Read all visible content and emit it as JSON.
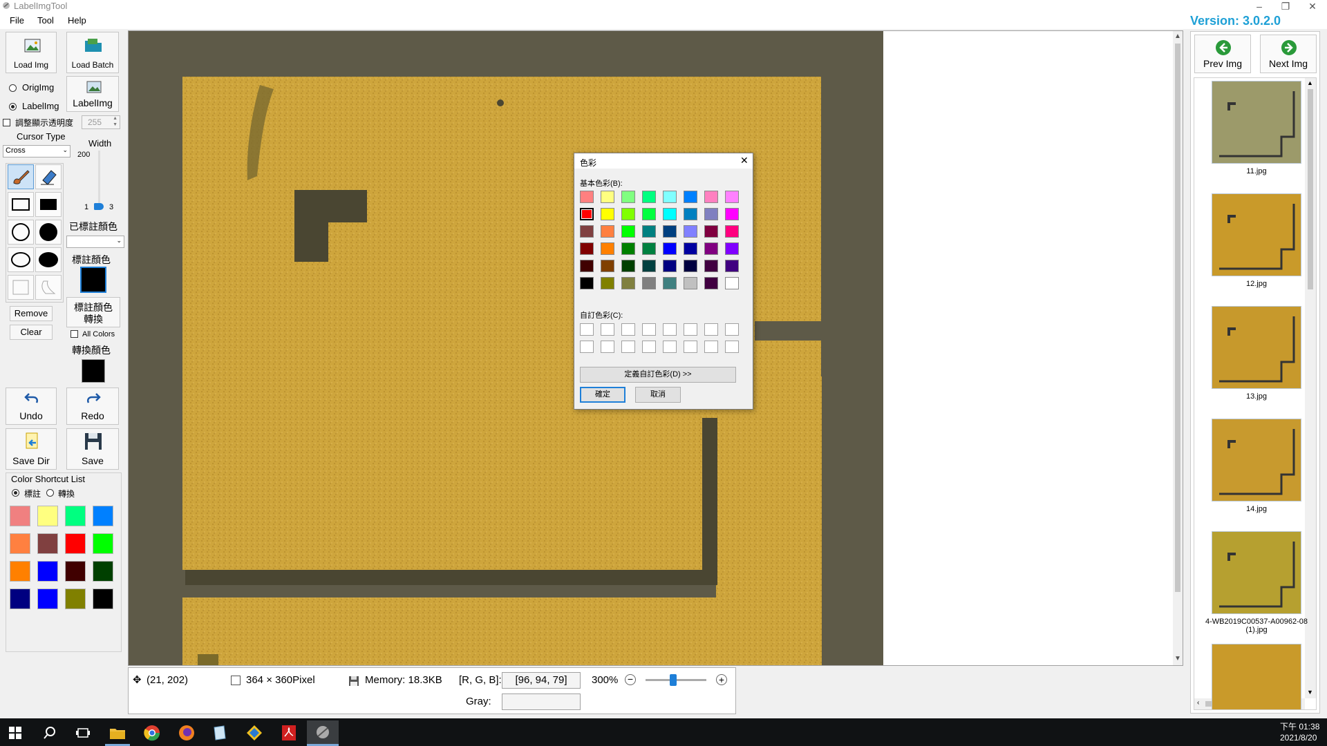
{
  "window": {
    "title": "LabelImgTool",
    "version": "Version: 3.0.2.0"
  },
  "menu": [
    "File",
    "Tool",
    "Help"
  ],
  "left": {
    "load_img": "Load Img",
    "load_batch": "Load Batch",
    "orig_img": "OrigImg",
    "label_img_radio": "LabelImg",
    "label_img_btn": "LabelImg",
    "adjust_opacity": "調整顯示透明度",
    "opacity_value": "255",
    "cursor_type_label": "Cursor Type",
    "cursor_type_value": "Cross",
    "width_label": "Width",
    "width_max": "200",
    "width_min": "1",
    "width_value": "3",
    "labeled_color": "已標註顏色",
    "label_color": "標註顏色",
    "label_color_convert_1": "標註顏色",
    "label_color_convert_2": "轉換",
    "remove": "Remove",
    "clear": "Clear",
    "all_colors": "All Colors",
    "convert_color": "轉換顏色",
    "undo": "Undo",
    "redo": "Redo",
    "save_dir": "Save Dir",
    "save": "Save",
    "shortcut_title": "Color Shortcut List",
    "radio_label": "標註",
    "radio_convert": "轉換",
    "shortcut_colors": [
      "#f08080",
      "#ffff80",
      "#00ff80",
      "#0080ff",
      "#ff8040",
      "#804040",
      "#ff0000",
      "#00ff00",
      "#ff8000",
      "#0000ff",
      "#400000",
      "#004000",
      "#000080",
      "#0000ff",
      "#808000",
      "#000000"
    ]
  },
  "status": {
    "coords": "(21, 202)",
    "size": "364 × 360Pixel",
    "memory": "Memory: 18.3KB",
    "rgb_label": "[R, G, B]:",
    "rgb_value": "[96, 94, 79]",
    "zoom": "300%",
    "gray_label": "Gray:",
    "gray_value": "",
    "zoom_slider_fraction": 0.45
  },
  "right": {
    "prev": "Prev Img",
    "next": "Next Img",
    "thumbs": [
      {
        "name": "11.jpg"
      },
      {
        "name": "12.jpg"
      },
      {
        "name": "13.jpg"
      },
      {
        "name": "14.jpg"
      },
      {
        "name": "4-WB2019C00537-A00962-08",
        "name2": "(1).jpg"
      }
    ]
  },
  "dialog": {
    "title": "色彩",
    "basic_label": "基本色彩(B):",
    "custom_label": "自訂色彩(C):",
    "define_custom": "定義自訂色彩(D) >>",
    "ok": "確定",
    "cancel": "取消",
    "basic_colors": [
      "#ff8080",
      "#ffff80",
      "#80ff80",
      "#00ff80",
      "#80ffff",
      "#0080ff",
      "#ff80c0",
      "#ff80ff",
      "#ff0000",
      "#ffff00",
      "#80ff00",
      "#00ff40",
      "#00ffff",
      "#0080c0",
      "#8080c0",
      "#ff00ff",
      "#804040",
      "#ff8040",
      "#00ff00",
      "#008080",
      "#004080",
      "#8080ff",
      "#800040",
      "#ff0080",
      "#800000",
      "#ff8000",
      "#008000",
      "#008040",
      "#0000ff",
      "#0000a0",
      "#800080",
      "#8000ff",
      "#400000",
      "#804000",
      "#004000",
      "#004040",
      "#000080",
      "#000040",
      "#400040",
      "#400080",
      "#000000",
      "#808000",
      "#808040",
      "#808080",
      "#408080",
      "#c0c0c0",
      "#400040",
      "#ffffff"
    ],
    "selected_index": 8
  },
  "taskbar": {
    "time": "下午 01:38",
    "date": "2021/8/20"
  }
}
